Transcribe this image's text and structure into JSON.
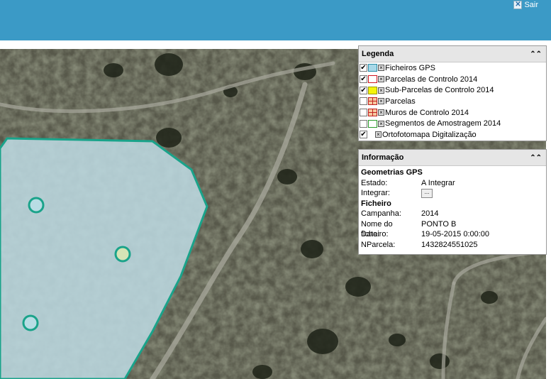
{
  "header": {
    "logout_label": "Sair",
    "logout_icon": "close-icon"
  },
  "legend": {
    "title": "Legenda",
    "collapse_icon": "double-chevron-up-icon",
    "layers": [
      {
        "label": "Ficheiros GPS",
        "checked": true,
        "symbol_fill": "#a8d8e8",
        "symbol_border": "#2a8ea8"
      },
      {
        "label": "Parcelas de Controlo 2014",
        "checked": true,
        "symbol_fill": "#ffffff",
        "symbol_border": "#d0141e"
      },
      {
        "label": "Sub-Parcelas de Controlo 2014",
        "checked": true,
        "symbol_fill": "#f4f40a",
        "symbol_border": "#9a9a00"
      },
      {
        "label": "Parcelas",
        "checked": false,
        "symbol_fill": "#f6c9a0",
        "symbol_border": "#c02020"
      },
      {
        "label": "Muros de Controlo 2014",
        "checked": false,
        "symbol_fill": "#f6c9a0",
        "symbol_border": "#c02020"
      },
      {
        "label": "Segmentos de Amostragem 2014",
        "checked": false,
        "symbol_fill": "#ffffff",
        "symbol_border": "#2a9a2a"
      },
      {
        "label": "Ortofotomapa Digitalização",
        "checked": true,
        "symbol_fill": "",
        "symbol_border": ""
      }
    ]
  },
  "info": {
    "title": "Informação",
    "section1": "Geometrias GPS",
    "estado_label": "Estado:",
    "estado_value": "A Integrar",
    "integrar_label": "Integrar:",
    "integrar_button": "...",
    "section2": "Ficheiro",
    "campanha_label": "Campanha:",
    "campanha_value": "2014",
    "nome_label": "Nome do ficheiro:",
    "nome_value": "PONTO B",
    "data_label": "Data:",
    "data_value": "19-05-2015 0:00:00",
    "nparcela_label": "NParcela:",
    "nparcela_value": "1432824551025"
  },
  "map": {
    "polygon_fill": "#bcd8e0",
    "polygon_stroke": "#1aa38a",
    "point_count": 3
  }
}
